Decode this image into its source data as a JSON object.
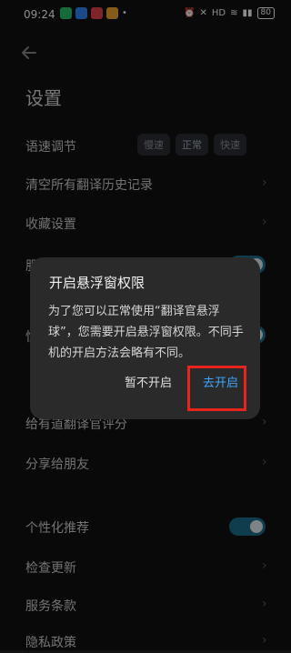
{
  "status_bar": {
    "time": "09:24",
    "dot": "•",
    "battery": "80",
    "signal_text": "HD"
  },
  "header": {
    "title": "设置"
  },
  "settings": {
    "speech_speed": {
      "label": "语速调节",
      "options": [
        "慢速",
        "正常",
        "快速"
      ],
      "selected": "正常"
    },
    "clear_history": {
      "label": "清空所有翻译历史记录"
    },
    "favorites": {
      "label": "收藏设置"
    },
    "hidden_row_1": {
      "label": "服"
    },
    "hidden_row_2": {
      "label": "性"
    },
    "rate": {
      "label": "给有道翻译官评分"
    },
    "share": {
      "label": "分享给朋友"
    },
    "personalized": {
      "label": "个性化推荐",
      "enabled": true
    },
    "check_update": {
      "label": "检查更新"
    },
    "terms": {
      "label": "服务条款"
    },
    "privacy": {
      "label": "隐私政策"
    }
  },
  "dialog": {
    "title": "开启悬浮窗权限",
    "message": "为了您可以正常使用“翻译官悬浮球”，您需要开启悬浮窗权限。不同手机的开启方法会略有不同。",
    "cancel_label": "暂不开启",
    "confirm_label": "去开启"
  },
  "colors": {
    "accent": "#3fa6ff",
    "toggle_on": "#1e6f8f",
    "highlight": "#e8251c"
  }
}
